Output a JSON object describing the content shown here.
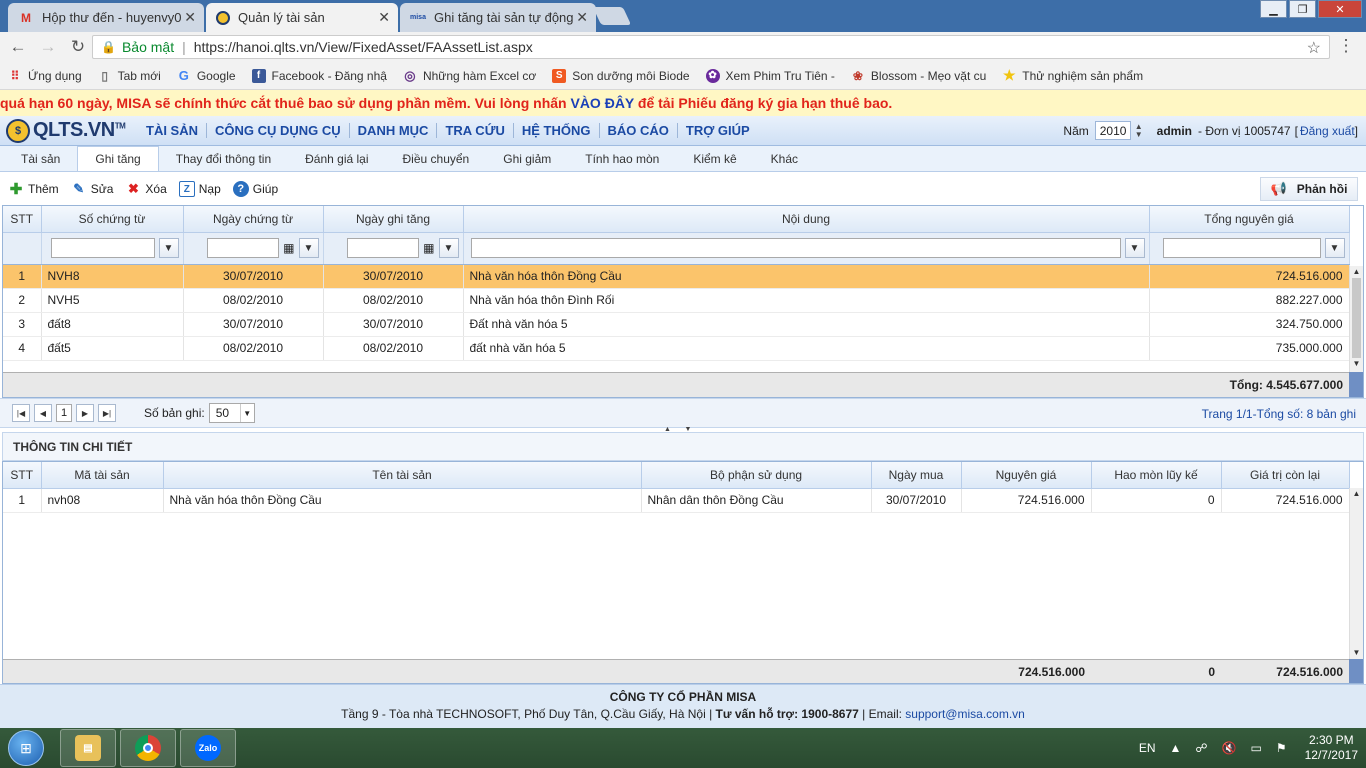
{
  "browser": {
    "tabs": [
      {
        "title": "Hộp thư đến - huyenvy0"
      },
      {
        "title": "Quản lý tài sản"
      },
      {
        "title": "Ghi tăng tài sản tự động"
      }
    ],
    "secure_label": "Bảo mật",
    "url": "https://hanoi.qlts.vn/View/FixedAsset/FAAssetList.aspx",
    "bookmarks": [
      {
        "label": "Ứng dụng",
        "icon": "apps-grid-icon"
      },
      {
        "label": "Tab mới",
        "icon": "document-icon"
      },
      {
        "label": "Google",
        "icon": "google-icon"
      },
      {
        "label": "Facebook - Đăng nhậ",
        "icon": "facebook-icon"
      },
      {
        "label": "Những hàm Excel cơ",
        "icon": "circle-logo-icon"
      },
      {
        "label": "Son dưỡng môi Biode",
        "icon": "shop-bag-icon"
      },
      {
        "label": "Xem Phim Tru Tiên -",
        "icon": "film-reel-icon"
      },
      {
        "label": "Blossom - Mẹo vặt cu",
        "icon": "blossom-icon"
      },
      {
        "label": "Thử nghiệm sản phẩm",
        "icon": "star-icon"
      }
    ]
  },
  "banner": {
    "text": "quá hạn 60 ngày, MISA sẽ chính thức cắt thuê bao sử dụng phần mềm. Vui lòng nhấn ",
    "link": "VÀO ĐÂY",
    "text_after": " để tải Phiếu đăng ký gia hạn thuê bao."
  },
  "app": {
    "logo": "QLTS.VN",
    "logo_tm": "TM",
    "menu": [
      "TÀI SẢN",
      "CÔNG CỤ DỤNG CỤ",
      "DANH MỤC",
      "TRA CỨU",
      "HỆ THỐNG",
      "BÁO CÁO",
      "TRỢ GIÚP"
    ],
    "year_label": "Năm",
    "year": "2010",
    "user": "admin",
    "unit": "- Đơn vị 1005747",
    "logout": "Đăng xuất"
  },
  "subtabs": [
    "Tài sản",
    "Ghi tăng",
    "Thay đổi thông tin",
    "Đánh giá lại",
    "Điều chuyển",
    "Ghi giảm",
    "Tính hao mòn",
    "Kiểm kê",
    "Khác"
  ],
  "toolbar": {
    "add": "Thêm",
    "edit": "Sửa",
    "delete": "Xóa",
    "reload": "Nạp",
    "help": "Giúp",
    "feedback": "Phản hồi"
  },
  "main_grid": {
    "headers": [
      "STT",
      "Số chứng từ",
      "Ngày chứng từ",
      "Ngày ghi tăng",
      "Nội dung",
      "Tổng nguyên giá"
    ],
    "rows": [
      {
        "stt": "1",
        "so": "NVH8",
        "ngay_ct": "30/07/2010",
        "ngay_gt": "30/07/2010",
        "noi_dung": "Nhà văn hóa thôn Đồng Cầu",
        "tong": "724.516.000"
      },
      {
        "stt": "2",
        "so": "NVH5",
        "ngay_ct": "08/02/2010",
        "ngay_gt": "08/02/2010",
        "noi_dung": "Nhà văn hóa thôn Đình Rối",
        "tong": "882.227.000"
      },
      {
        "stt": "3",
        "so": "đất8",
        "ngay_ct": "30/07/2010",
        "ngay_gt": "30/07/2010",
        "noi_dung": "Đất nhà văn hóa 5",
        "tong": "324.750.000"
      },
      {
        "stt": "4",
        "so": "đất5",
        "ngay_ct": "08/02/2010",
        "ngay_gt": "08/02/2010",
        "noi_dung": "đất nhà văn hóa 5",
        "tong": "735.000.000"
      }
    ],
    "total": "Tổng: 4.545.677.000"
  },
  "pager": {
    "page": "1",
    "records_label": "Số bản ghi:",
    "page_size": "50",
    "info": "Trang 1/1-Tổng số: 8 bản ghi"
  },
  "detail": {
    "title": "THÔNG TIN CHI TIẾT",
    "headers": [
      "STT",
      "Mã tài sản",
      "Tên tài sản",
      "Bộ phận sử dụng",
      "Ngày mua",
      "Nguyên giá",
      "Hao mòn lũy kế",
      "Giá trị còn lại"
    ],
    "rows": [
      {
        "stt": "1",
        "ma": "nvh08",
        "ten": "Nhà văn hóa thôn Đồng Cầu",
        "bo_phan": "Nhân dân thôn Đồng Cầu",
        "ngay_mua": "30/07/2010",
        "nguyen_gia": "724.516.000",
        "hao_mon": "0",
        "con_lai": "724.516.000"
      }
    ],
    "totals": {
      "nguyen_gia": "724.516.000",
      "hao_mon": "0",
      "con_lai": "724.516.000"
    }
  },
  "footer": {
    "company": "CÔNG TY CỔ PHẦN MISA",
    "address": "Tầng 9 - Tòa nhà TECHNOSOFT, Phố Duy Tân, Q.Cầu Giấy, Hà Nội | ",
    "support_label": "Tư vấn hỗ trợ: 1900-8677",
    "email_label": " | Email: ",
    "email": "support@misa.com.vn"
  },
  "taskbar": {
    "lang": "EN",
    "time": "2:30 PM",
    "date": "12/7/2017",
    "apps": [
      "file-explorer-icon",
      "chrome-icon",
      "zalo-icon"
    ],
    "zalo_label": "Zalo"
  }
}
